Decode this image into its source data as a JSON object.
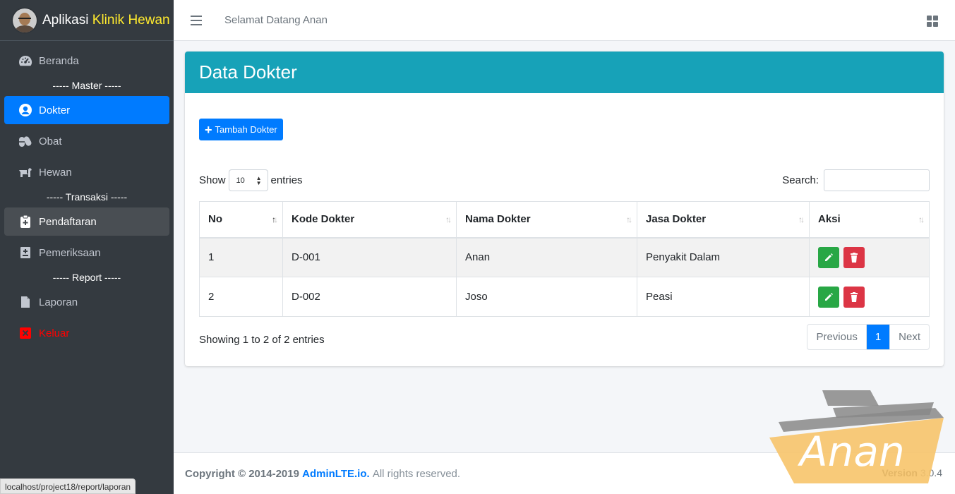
{
  "app": {
    "brand_prefix": "Aplikasi",
    "brand_highlight": "Klinik Hewan"
  },
  "sidebar": {
    "beranda": "Beranda",
    "header_master": "----- Master -----",
    "dokter": "Dokter",
    "obat": "Obat",
    "hewan": "Hewan",
    "header_transaksi": "----- Transaksi -----",
    "pendaftaran": "Pendaftaran",
    "pemeriksaan": "Pemeriksaan",
    "header_report": "----- Report -----",
    "laporan": "Laporan",
    "keluar": "Keluar"
  },
  "topbar": {
    "welcome": "Selamat Datang Anan"
  },
  "card": {
    "title": "Data Dokter",
    "add_button": "Tambah Dokter"
  },
  "datatable": {
    "show_label": "Show",
    "page_size": "10",
    "entries_label": "entries",
    "search_label": "Search:",
    "search_value": "",
    "columns": [
      "No",
      "Kode Dokter",
      "Nama Dokter",
      "Jasa Dokter",
      "Aksi"
    ],
    "rows": [
      {
        "no": "1",
        "kode": "D-001",
        "nama": "Anan",
        "jasa": "Penyakit Dalam"
      },
      {
        "no": "2",
        "kode": "D-002",
        "nama": "Joso",
        "jasa": "Peasi"
      }
    ],
    "info": "Showing 1 to 2 of 2 entries",
    "pagination": {
      "previous": "Previous",
      "current": "1",
      "next": "Next"
    }
  },
  "footer": {
    "copyright": "Copyright © 2014-2019",
    "link": "AdminLTE.io.",
    "rights": "All rights reserved.",
    "version_label": "Version",
    "version": "3.0.4"
  },
  "statusbar": {
    "url": "localhost/project18/report/laporan"
  },
  "watermark": {
    "text": "Anan"
  },
  "colors": {
    "sidebar": "#343a40",
    "primary": "#007bff",
    "info": "#17a2b8",
    "success": "#28a745",
    "danger": "#dc3545",
    "brand_highlight": "#ffea2e"
  }
}
